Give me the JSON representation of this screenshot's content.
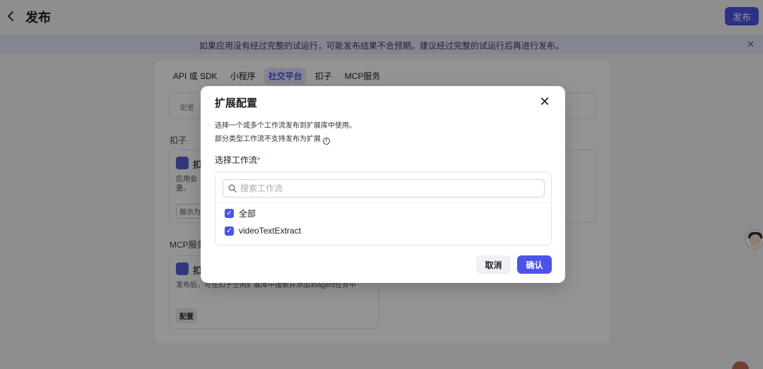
{
  "header": {
    "title": "发布",
    "publish_label": "发布"
  },
  "banner": {
    "text": "如果应用没有经过完整的试运行，可能发布结果不合预期。建议经过完整的试运行后再进行发布。"
  },
  "tabs": [
    {
      "label": "API 或 SDK",
      "active": false
    },
    {
      "label": "小程序",
      "active": false
    },
    {
      "label": "社交平台",
      "active": true
    },
    {
      "label": "扣子",
      "active": false
    },
    {
      "label": "MCP服务",
      "active": false
    }
  ],
  "background": {
    "config_label": "配置",
    "section_kouzi": "扣子",
    "section_mcp": "MCP服务",
    "card_title_partial": "扣",
    "card1_desc_partial": "应用会",
    "card1_desc_line2": "量。",
    "card1_tag_partial": "展示为",
    "card2_desc": "发布后，可在扣子空间扩展库中搜索并添加到agent任务中",
    "card2_config_label": "配置"
  },
  "modal": {
    "title": "扩展配置",
    "desc_line1": "选择一个或多个工作流发布到扩展库中使用。",
    "desc_line2": "部分类型工作流不支持发布为扩展",
    "field_label": "选择工作流",
    "required_mark": "*",
    "search_placeholder": "搜索工作流",
    "options": [
      {
        "label": "全部",
        "checked": true
      },
      {
        "label": "videoTextExtract",
        "checked": true
      }
    ],
    "cancel_label": "取消",
    "confirm_label": "确认"
  },
  "colors": {
    "accent": "#4d53e8",
    "banner_bg": "#e4e6fb",
    "required": "#e5484d"
  }
}
